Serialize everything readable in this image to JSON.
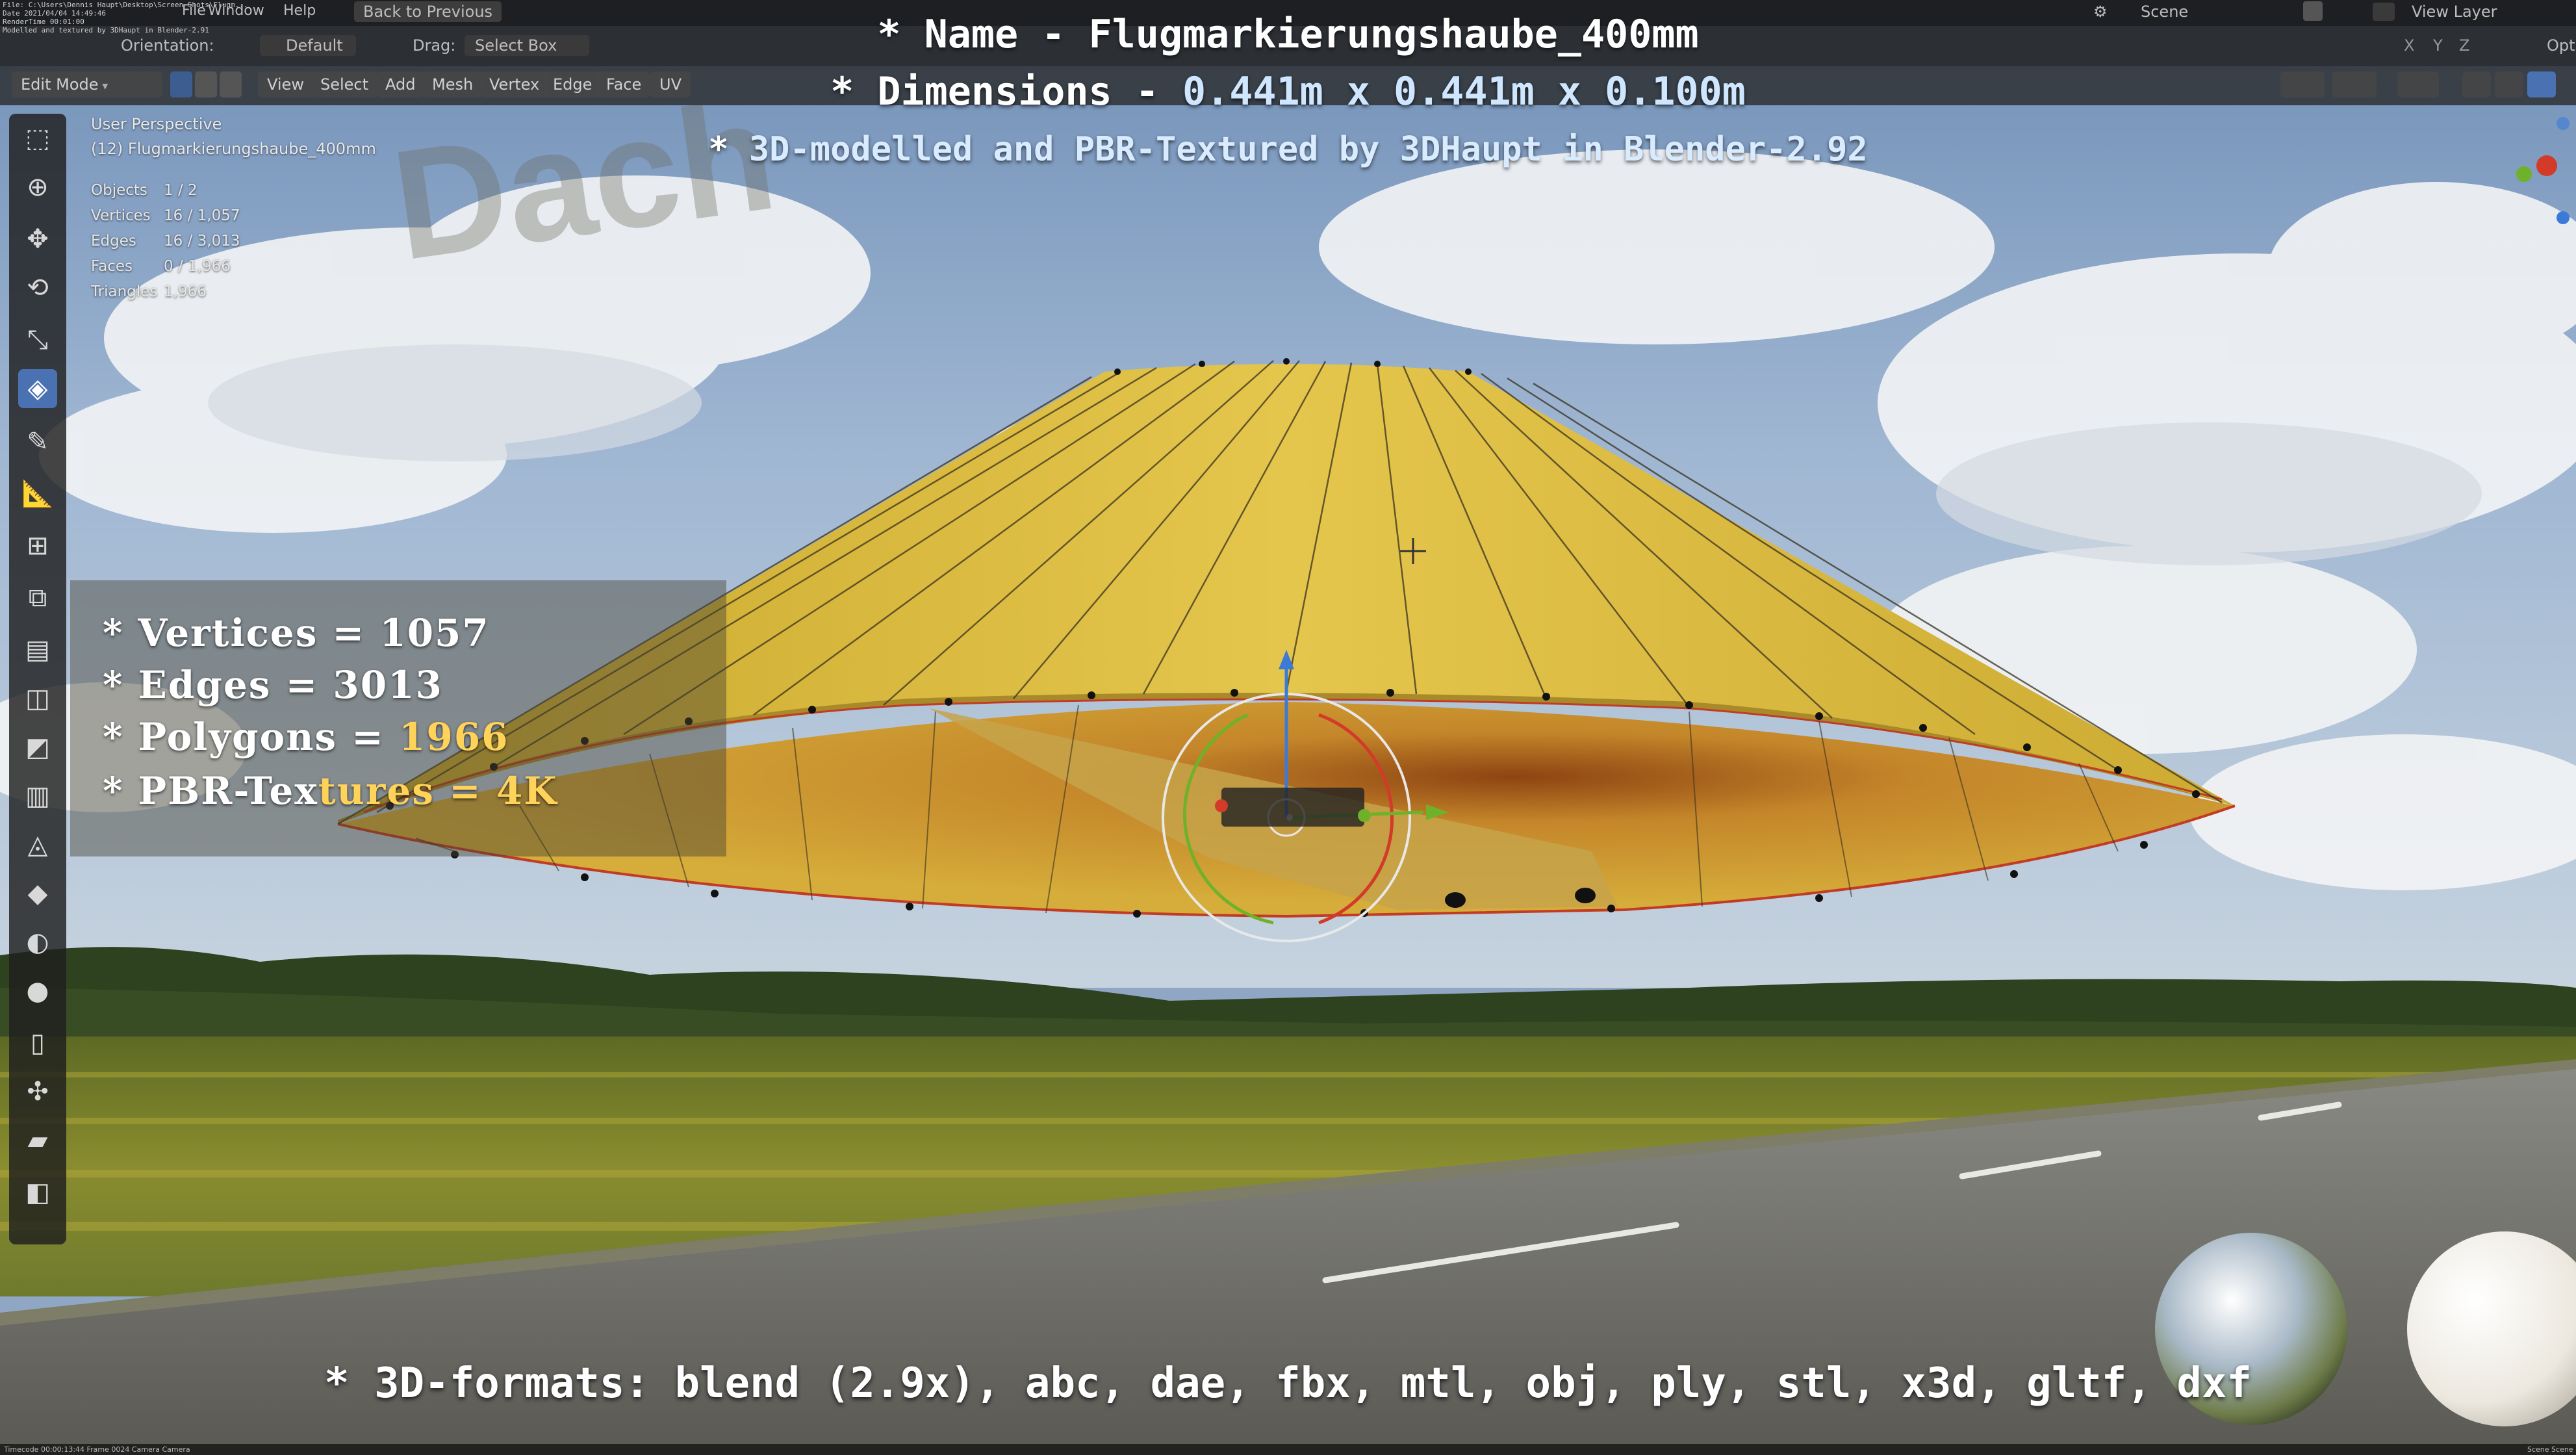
{
  "topbar": {
    "path_line_1": "File: C:\\Users\\Dennis Haupt\\Desktop\\Screen Shots\\Flugm...",
    "path_line_2": "Date 2021/04/04 14:49:46",
    "path_line_3": "RenderTime 00:01:00",
    "path_line_4": "Modelled and textured by 3DHaupt in Blender-2.91",
    "menu_file": "File",
    "menu_window": "Window",
    "menu_help": "Help",
    "back_to_previous": "Back to Previous",
    "scene_label": "Scene",
    "view_layer_label": "View Layer",
    "orientation_label": "Orientation:",
    "orientation_value": "Default",
    "drag_label": "Drag:",
    "drag_value": "Select Box",
    "options_label": "Opti"
  },
  "header": {
    "mode": "Edit Mode",
    "menus": [
      "View",
      "Select",
      "Add",
      "Mesh",
      "Vertex",
      "Edge",
      "Face",
      "UV"
    ],
    "axis_x": "X",
    "axis_y": "Y",
    "axis_z": "Z"
  },
  "viewport": {
    "perspective": "User Perspective",
    "object_name": "(12) Flugmarkierungshaube_400mm",
    "stats": [
      {
        "label": "Objects",
        "value": "1 / 2"
      },
      {
        "label": "Vertices",
        "value": "16 / 1,057"
      },
      {
        "label": "Edges",
        "value": "16 / 3,013"
      },
      {
        "label": "Faces",
        "value": "0 / 1,966"
      },
      {
        "label": "Triangles",
        "value": "1,966"
      }
    ]
  },
  "overlay": {
    "name_line": "* Name - Flugmarkierungshaube_400mm",
    "dims_prefix": "* Dimensions -  ",
    "dims_value": "0.441m x 0.441m x 0.100m",
    "model_prefix": "* ",
    "model_highlight": "3D-modelled and PBR-Textured by 3DHaupt in Blender-2.92",
    "vertices_line": "* Vertices = 1057",
    "edges_line": "* Edges = 3013",
    "polygons_prefix": "* Polygons = ",
    "polygons_value": "1966",
    "pbr_prefix": "* PBR-Tex",
    "pbr_highlight": "tures = 4K",
    "formats_line": "* 3D-formats: blend (2.9x), abc, dae, fbx, mtl, obj, ply, stl, x3d, gltf, dxf"
  },
  "bottombar": {
    "left": "Timecode 00:00:13:44   Frame 0024   Camera Camera",
    "right": "Scene Scene"
  },
  "colors": {
    "sky": "#8fa7c4",
    "hood_yellow": "#d9b83a",
    "inner_brown": "#b4771c",
    "field": "#6f7a2c",
    "road": "#6b6a62",
    "blender_active": "#4a72b3"
  },
  "toolbar_icons": [
    "select-box-icon",
    "cursor-icon",
    "move-icon",
    "rotate-icon",
    "scale-icon",
    "transform-icon",
    "annotate-icon",
    "measure-icon",
    "add-cube-icon",
    "extrude-region-icon",
    "extrude-individual-icon",
    "inset-faces-icon",
    "bevel-icon",
    "loop-cut-icon",
    "knife-icon",
    "poly-build-icon",
    "spin-icon",
    "smooth-icon",
    "edge-slide-icon",
    "shrink-fatten-icon",
    "shear-icon",
    "rip-region-icon"
  ]
}
